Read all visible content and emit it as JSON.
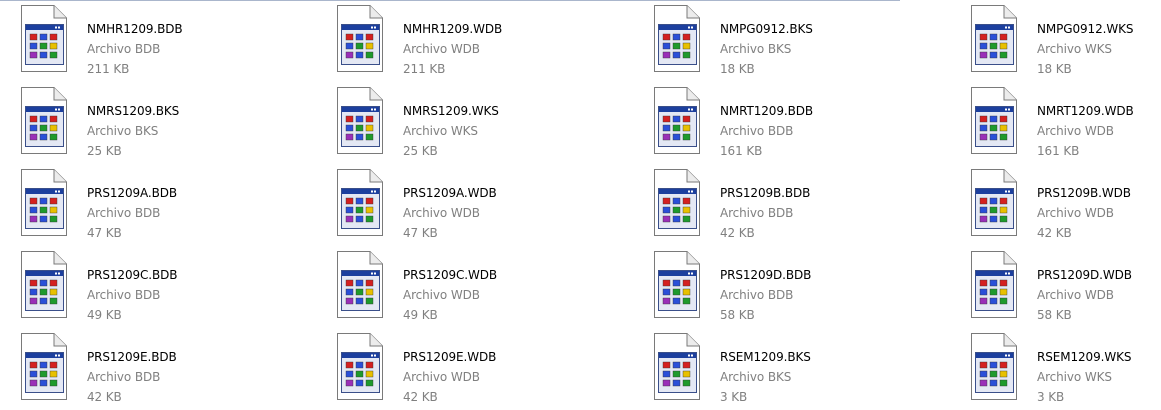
{
  "files": [
    {
      "name": "NMHR1209.BDB",
      "type": "Archivo BDB",
      "size": "211 KB"
    },
    {
      "name": "NMHR1209.WDB",
      "type": "Archivo WDB",
      "size": "211 KB"
    },
    {
      "name": "NMPG0912.BKS",
      "type": "Archivo BKS",
      "size": "18 KB"
    },
    {
      "name": "NMPG0912.WKS",
      "type": "Archivo WKS",
      "size": "18 KB"
    },
    {
      "name": "NMRS1209.BKS",
      "type": "Archivo BKS",
      "size": "25 KB"
    },
    {
      "name": "NMRS1209.WKS",
      "type": "Archivo WKS",
      "size": "25 KB"
    },
    {
      "name": "NMRT1209.BDB",
      "type": "Archivo BDB",
      "size": "161 KB"
    },
    {
      "name": "NMRT1209.WDB",
      "type": "Archivo WDB",
      "size": "161 KB"
    },
    {
      "name": "PRS1209A.BDB",
      "type": "Archivo BDB",
      "size": "47 KB"
    },
    {
      "name": "PRS1209A.WDB",
      "type": "Archivo WDB",
      "size": "47 KB"
    },
    {
      "name": "PRS1209B.BDB",
      "type": "Archivo BDB",
      "size": "42 KB"
    },
    {
      "name": "PRS1209B.WDB",
      "type": "Archivo WDB",
      "size": "42 KB"
    },
    {
      "name": "PRS1209C.BDB",
      "type": "Archivo BDB",
      "size": "49 KB"
    },
    {
      "name": "PRS1209C.WDB",
      "type": "Archivo WDB",
      "size": "49 KB"
    },
    {
      "name": "PRS1209D.BDB",
      "type": "Archivo BDB",
      "size": "58 KB"
    },
    {
      "name": "PRS1209D.WDB",
      "type": "Archivo WDB",
      "size": "58 KB"
    },
    {
      "name": "PRS1209E.BDB",
      "type": "Archivo BDB",
      "size": "42 KB"
    },
    {
      "name": "PRS1209E.WDB",
      "type": "Archivo WDB",
      "size": "42 KB"
    },
    {
      "name": "RSEM1209.BKS",
      "type": "Archivo BKS",
      "size": "3 KB"
    },
    {
      "name": "RSEM1209.WKS",
      "type": "Archivo WKS",
      "size": "3 KB"
    }
  ],
  "icon": "generic-application-file-icon",
  "colors": {
    "name_text": "#000000",
    "detail_text": "#808080",
    "background": "#ffffff",
    "icon_window_titlebar": "#1c3f9e",
    "icon_square_red": "#d42020",
    "icon_square_blue": "#2a4fd8",
    "icon_square_green": "#1f9a2c",
    "icon_square_yellow": "#e8c000",
    "icon_square_purple": "#9a2fb8"
  }
}
